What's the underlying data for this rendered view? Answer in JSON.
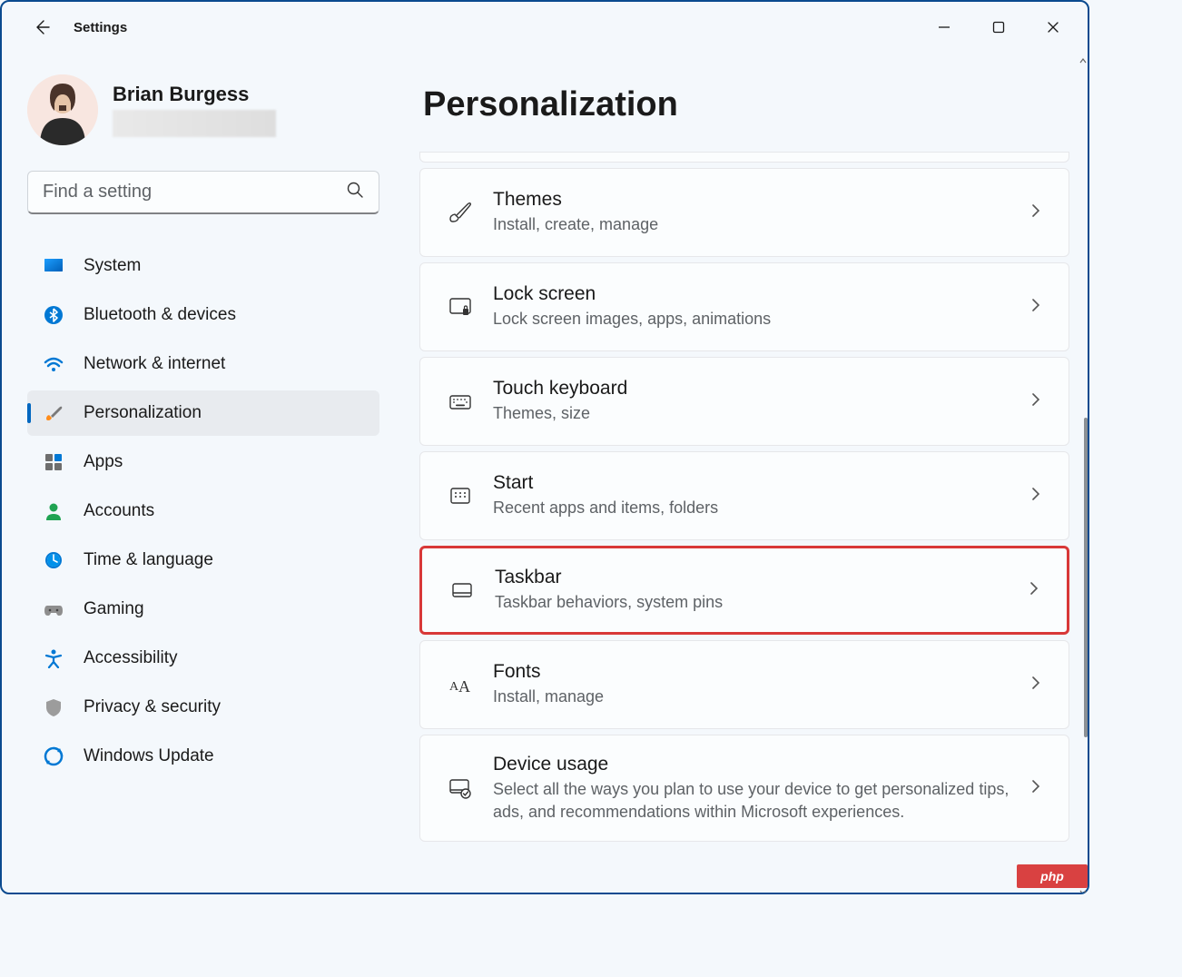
{
  "app": {
    "title": "Settings"
  },
  "profile": {
    "name": "Brian Burgess"
  },
  "search": {
    "placeholder": "Find a setting"
  },
  "nav": [
    {
      "key": "system",
      "label": "System"
    },
    {
      "key": "bluetooth",
      "label": "Bluetooth & devices"
    },
    {
      "key": "network",
      "label": "Network & internet"
    },
    {
      "key": "personalization",
      "label": "Personalization"
    },
    {
      "key": "apps",
      "label": "Apps"
    },
    {
      "key": "accounts",
      "label": "Accounts"
    },
    {
      "key": "time",
      "label": "Time & language"
    },
    {
      "key": "gaming",
      "label": "Gaming"
    },
    {
      "key": "accessibility",
      "label": "Accessibility"
    },
    {
      "key": "privacy",
      "label": "Privacy & security"
    },
    {
      "key": "update",
      "label": "Windows Update"
    }
  ],
  "page": {
    "title": "Personalization"
  },
  "cards": [
    {
      "key": "themes",
      "title": "Themes",
      "sub": "Install, create, manage"
    },
    {
      "key": "lockscreen",
      "title": "Lock screen",
      "sub": "Lock screen images, apps, animations"
    },
    {
      "key": "touchkeyboard",
      "title": "Touch keyboard",
      "sub": "Themes, size"
    },
    {
      "key": "start",
      "title": "Start",
      "sub": "Recent apps and items, folders"
    },
    {
      "key": "taskbar",
      "title": "Taskbar",
      "sub": "Taskbar behaviors, system pins"
    },
    {
      "key": "fonts",
      "title": "Fonts",
      "sub": "Install, manage"
    },
    {
      "key": "deviceusage",
      "title": "Device usage",
      "sub": "Select all the ways you plan to use your device to get personalized tips, ads, and recommendations within Microsoft experiences."
    }
  ],
  "badge": {
    "text": "php"
  }
}
